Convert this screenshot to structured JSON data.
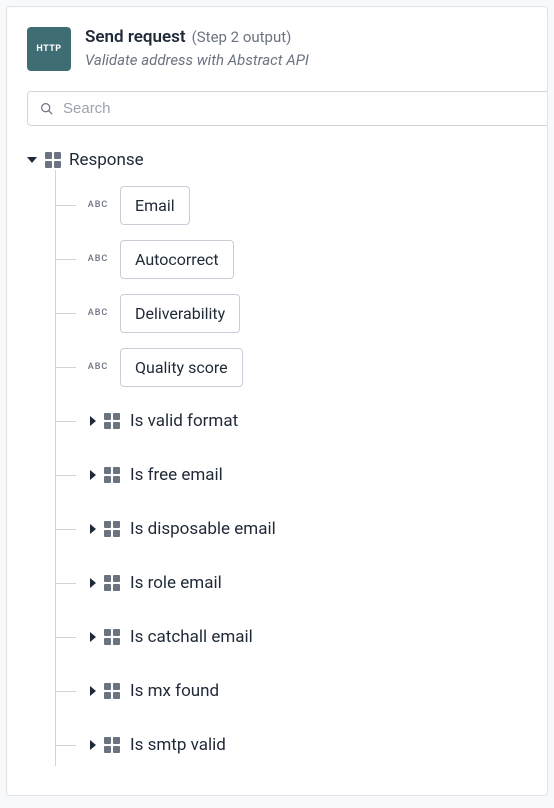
{
  "header": {
    "icon_label": "HTTP",
    "title": "Send request",
    "step": "(Step 2 output)",
    "subtitle": "Validate address with Abstract API"
  },
  "search": {
    "placeholder": "Search"
  },
  "tree": {
    "root_label": "Response",
    "string_fields": [
      {
        "label": "Email"
      },
      {
        "label": "Autocorrect"
      },
      {
        "label": "Deliverability"
      },
      {
        "label": "Quality score"
      }
    ],
    "object_fields": [
      {
        "label": "Is valid format"
      },
      {
        "label": "Is free email"
      },
      {
        "label": "Is disposable email"
      },
      {
        "label": "Is role email"
      },
      {
        "label": "Is catchall email"
      },
      {
        "label": "Is mx found"
      },
      {
        "label": "Is smtp valid"
      }
    ]
  }
}
